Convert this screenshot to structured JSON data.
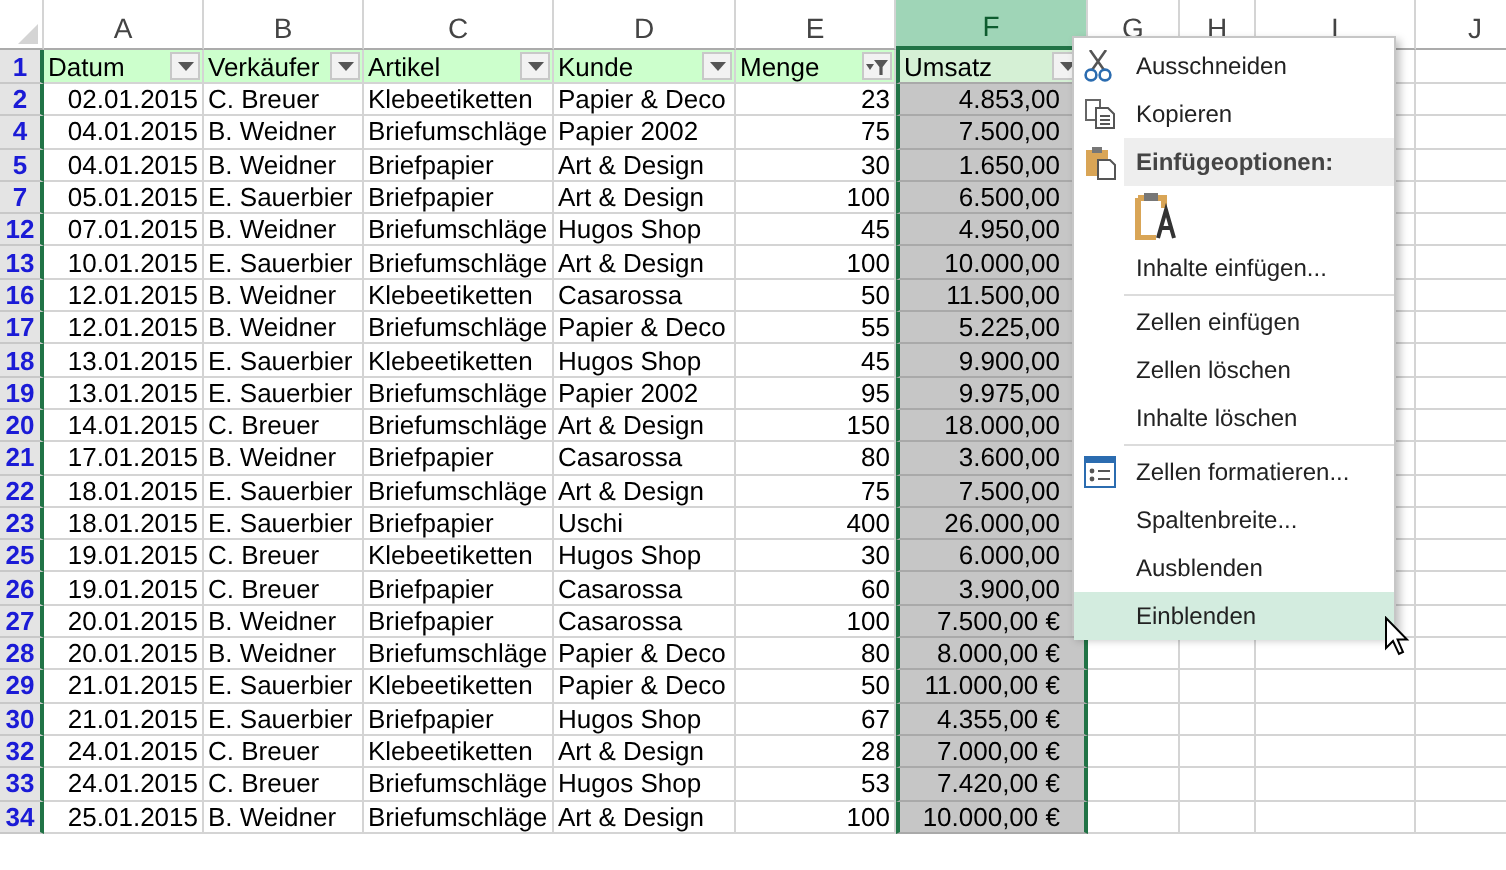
{
  "column_headers": [
    {
      "label": "A",
      "selected": false
    },
    {
      "label": "B",
      "selected": false
    },
    {
      "label": "C",
      "selected": false
    },
    {
      "label": "D",
      "selected": false
    },
    {
      "label": "E",
      "selected": false
    },
    {
      "label": "F",
      "selected": true
    },
    {
      "label": "G",
      "selected": false
    },
    {
      "label": "H",
      "selected": false
    },
    {
      "label": "I",
      "selected": false
    },
    {
      "label": "J",
      "selected": false
    }
  ],
  "header_row": {
    "row_number": "1",
    "cells": [
      {
        "text": "Datum",
        "filtered": false
      },
      {
        "text": "Verkäufer",
        "filtered": false
      },
      {
        "text": "Artikel",
        "filtered": false
      },
      {
        "text": "Kunde",
        "filtered": false
      },
      {
        "text": "Menge",
        "filtered": true
      },
      {
        "text": "Umsatz",
        "filtered": false
      }
    ]
  },
  "rows": [
    {
      "row_number": "2",
      "cells": [
        "02.01.2015",
        "C. Breuer",
        "Klebeetiketten",
        "Papier & Deco",
        "23",
        "4.853,00"
      ]
    },
    {
      "row_number": "4",
      "cells": [
        "04.01.2015",
        "B. Weidner",
        "Briefumschläge",
        "Papier 2002",
        "75",
        "7.500,00"
      ]
    },
    {
      "row_number": "5",
      "cells": [
        "04.01.2015",
        "B. Weidner",
        "Briefpapier",
        "Art & Design",
        "30",
        "1.650,00"
      ]
    },
    {
      "row_number": "7",
      "cells": [
        "05.01.2015",
        "E. Sauerbier",
        "Briefpapier",
        "Art & Design",
        "100",
        "6.500,00"
      ]
    },
    {
      "row_number": "12",
      "cells": [
        "07.01.2015",
        "B. Weidner",
        "Briefumschläge",
        "Hugos Shop",
        "45",
        "4.950,00"
      ]
    },
    {
      "row_number": "13",
      "cells": [
        "10.01.2015",
        "E. Sauerbier",
        "Briefumschläge",
        "Art & Design",
        "100",
        "10.000,00"
      ]
    },
    {
      "row_number": "16",
      "cells": [
        "12.01.2015",
        "B. Weidner",
        "Klebeetiketten",
        "Casarossa",
        "50",
        "11.500,00"
      ]
    },
    {
      "row_number": "17",
      "cells": [
        "12.01.2015",
        "B. Weidner",
        "Briefumschläge",
        "Papier & Deco",
        "55",
        "5.225,00"
      ]
    },
    {
      "row_number": "18",
      "cells": [
        "13.01.2015",
        "E. Sauerbier",
        "Klebeetiketten",
        "Hugos Shop",
        "45",
        "9.900,00"
      ]
    },
    {
      "row_number": "19",
      "cells": [
        "13.01.2015",
        "E. Sauerbier",
        "Briefumschläge",
        "Papier 2002",
        "95",
        "9.975,00"
      ]
    },
    {
      "row_number": "20",
      "cells": [
        "14.01.2015",
        "C. Breuer",
        "Briefumschläge",
        "Art & Design",
        "150",
        "18.000,00"
      ]
    },
    {
      "row_number": "21",
      "cells": [
        "17.01.2015",
        "B. Weidner",
        "Briefpapier",
        "Casarossa",
        "80",
        "3.600,00"
      ]
    },
    {
      "row_number": "22",
      "cells": [
        "18.01.2015",
        "E. Sauerbier",
        "Briefumschläge",
        "Art & Design",
        "75",
        "7.500,00"
      ]
    },
    {
      "row_number": "23",
      "cells": [
        "18.01.2015",
        "E. Sauerbier",
        "Briefpapier",
        "Uschi",
        "400",
        "26.000,00"
      ]
    },
    {
      "row_number": "25",
      "cells": [
        "19.01.2015",
        "C. Breuer",
        "Klebeetiketten",
        "Hugos Shop",
        "30",
        "6.000,00"
      ]
    },
    {
      "row_number": "26",
      "cells": [
        "19.01.2015",
        "C. Breuer",
        "Briefpapier",
        "Casarossa",
        "60",
        "3.900,00"
      ]
    },
    {
      "row_number": "27",
      "cells": [
        "20.01.2015",
        "B. Weidner",
        "Briefpapier",
        "Casarossa",
        "100",
        "7.500,00 €"
      ]
    },
    {
      "row_number": "28",
      "cells": [
        "20.01.2015",
        "B. Weidner",
        "Briefumschläge",
        "Papier & Deco",
        "80",
        "8.000,00 €"
      ]
    },
    {
      "row_number": "29",
      "cells": [
        "21.01.2015",
        "E. Sauerbier",
        "Klebeetiketten",
        "Papier & Deco",
        "50",
        "11.000,00 €"
      ]
    },
    {
      "row_number": "30",
      "cells": [
        "21.01.2015",
        "E. Sauerbier",
        "Briefpapier",
        "Hugos Shop",
        "67",
        "4.355,00 €"
      ]
    },
    {
      "row_number": "32",
      "cells": [
        "24.01.2015",
        "C. Breuer",
        "Klebeetiketten",
        "Art & Design",
        "28",
        "7.000,00 €"
      ]
    },
    {
      "row_number": "33",
      "cells": [
        "24.01.2015",
        "C. Breuer",
        "Briefumschläge",
        "Hugos Shop",
        "53",
        "7.420,00 €"
      ]
    },
    {
      "row_number": "34",
      "cells": [
        "25.01.2015",
        "B. Weidner",
        "Briefumschläge",
        "Art & Design",
        "100",
        "10.000,00 €"
      ]
    }
  ],
  "context_menu": {
    "items": [
      {
        "kind": "cut",
        "label": "Ausschneiden",
        "hovered": false
      },
      {
        "kind": "copy",
        "label": "Kopieren",
        "hovered": false
      },
      {
        "kind": "paste-header",
        "label": "Einfügeoptionen:"
      },
      {
        "kind": "paste-option"
      },
      {
        "kind": "command",
        "label": "Inhalte einfügen...",
        "hovered": false
      },
      {
        "kind": "separator"
      },
      {
        "kind": "command",
        "label": "Zellen einfügen",
        "hovered": false
      },
      {
        "kind": "command",
        "label": "Zellen löschen",
        "hovered": false
      },
      {
        "kind": "command",
        "label": "Inhalte löschen",
        "hovered": false
      },
      {
        "kind": "separator"
      },
      {
        "kind": "format",
        "label": "Zellen formatieren...",
        "hovered": false
      },
      {
        "kind": "command",
        "label": "Spaltenbreite...",
        "hovered": false
      },
      {
        "kind": "command",
        "label": "Ausblenden",
        "hovered": false
      },
      {
        "kind": "command",
        "label": "Einblenden",
        "hovered": true
      }
    ]
  }
}
